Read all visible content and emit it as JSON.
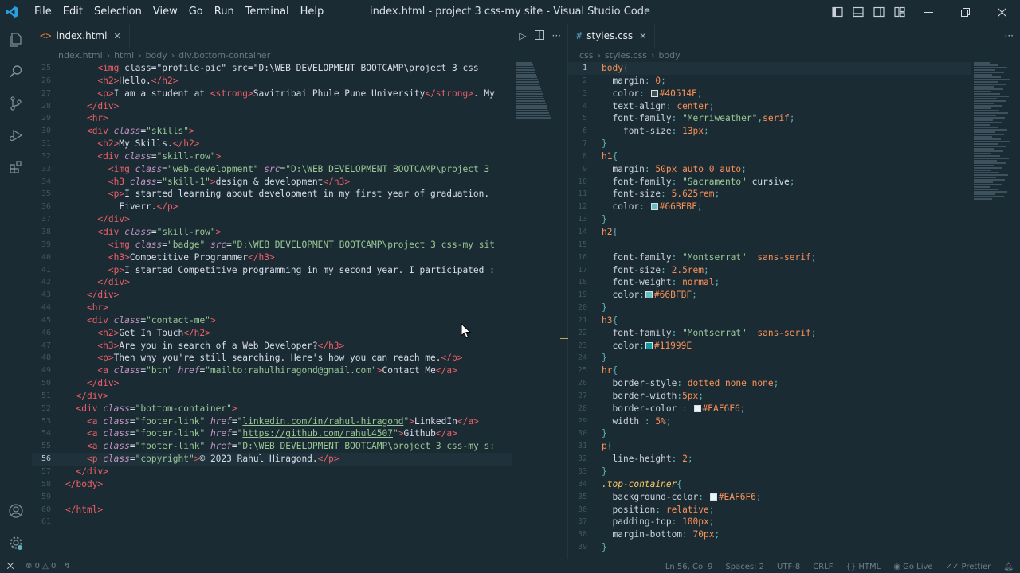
{
  "window": {
    "title": "index.html - project 3 css-my site - Visual Studio Code",
    "menu": [
      "File",
      "Edit",
      "Selection",
      "View",
      "Go",
      "Run",
      "Terminal",
      "Help"
    ]
  },
  "left_editor": {
    "tab": {
      "label": "index.html"
    },
    "breadcrumb": [
      "index.html",
      "html",
      "body",
      "div.bottom-container"
    ],
    "first_line": 25,
    "current_line": 56
  },
  "right_editor": {
    "tab": {
      "label": "styles.css"
    },
    "breadcrumb": [
      "css",
      "styles.css",
      "body"
    ],
    "first_line": 1,
    "current_line": 1
  },
  "html_lines": [
    [
      [
        "pl",
        "      "
      ],
      [
        "tg",
        "<img"
      ],
      [
        "pl",
        " class=\"profile-pic\" src=\"D:\\WEB DEVELOPMENT BOOTCAMP\\project 3 css"
      ]
    ],
    [
      [
        "pl",
        "      "
      ],
      [
        "tg",
        "<h2>"
      ],
      [
        "pl",
        "Hello."
      ],
      [
        "tg",
        "</h2>"
      ]
    ],
    [
      [
        "pl",
        "      "
      ],
      [
        "tg",
        "<p>"
      ],
      [
        "pl",
        "I am a student at "
      ],
      [
        "tg",
        "<strong>"
      ],
      [
        "pl",
        "Savitribai Phule Pune University"
      ],
      [
        "tg",
        "</strong>"
      ],
      [
        "pl",
        ". My"
      ]
    ],
    [
      [
        "pl",
        "    "
      ],
      [
        "tg",
        "</div>"
      ]
    ],
    [
      [
        "pl",
        "    "
      ],
      [
        "tg",
        "<hr>"
      ]
    ],
    [
      [
        "pl",
        "    "
      ],
      [
        "tg",
        "<div"
      ],
      [
        "pl",
        " "
      ],
      [
        "at",
        "class"
      ],
      [
        "pl",
        "="
      ],
      [
        "st",
        "\"skills\""
      ],
      [
        "tg",
        ">"
      ]
    ],
    [
      [
        "pl",
        "      "
      ],
      [
        "tg",
        "<h2>"
      ],
      [
        "pl",
        "My Skills."
      ],
      [
        "tg",
        "</h2>"
      ]
    ],
    [
      [
        "pl",
        "      "
      ],
      [
        "tg",
        "<div"
      ],
      [
        "pl",
        " "
      ],
      [
        "at",
        "class"
      ],
      [
        "pl",
        "="
      ],
      [
        "st",
        "\"skill-row\""
      ],
      [
        "tg",
        ">"
      ]
    ],
    [
      [
        "pl",
        "        "
      ],
      [
        "tg",
        "<img"
      ],
      [
        "pl",
        " "
      ],
      [
        "at",
        "class"
      ],
      [
        "pl",
        "="
      ],
      [
        "st",
        "\"web-development\""
      ],
      [
        "pl",
        " "
      ],
      [
        "at",
        "src"
      ],
      [
        "pl",
        "="
      ],
      [
        "st",
        "\"D:\\WEB DEVELOPMENT BOOTCAMP\\project 3"
      ]
    ],
    [
      [
        "pl",
        "        "
      ],
      [
        "tg",
        "<h3"
      ],
      [
        "pl",
        " "
      ],
      [
        "at",
        "class"
      ],
      [
        "pl",
        "="
      ],
      [
        "st",
        "\"skill-1\""
      ],
      [
        "tg",
        ">"
      ],
      [
        "pl",
        "design & development"
      ],
      [
        "tg",
        "</h3>"
      ]
    ],
    [
      [
        "pl",
        "        "
      ],
      [
        "tg",
        "<p>"
      ],
      [
        "pl",
        "I started learning about development in my first year of graduation."
      ]
    ],
    [
      [
        "pl",
        "          Fiverr."
      ],
      [
        "tg",
        "</p>"
      ]
    ],
    [
      [
        "pl",
        "      "
      ],
      [
        "tg",
        "</div>"
      ]
    ],
    [
      [
        "pl",
        "      "
      ],
      [
        "tg",
        "<div"
      ],
      [
        "pl",
        " "
      ],
      [
        "at",
        "class"
      ],
      [
        "pl",
        "="
      ],
      [
        "st",
        "\"skill-row\""
      ],
      [
        "tg",
        ">"
      ]
    ],
    [
      [
        "pl",
        "        "
      ],
      [
        "tg",
        "<img"
      ],
      [
        "pl",
        " "
      ],
      [
        "at",
        "class"
      ],
      [
        "pl",
        "="
      ],
      [
        "st",
        "\"badge\""
      ],
      [
        "pl",
        " "
      ],
      [
        "at",
        "src"
      ],
      [
        "pl",
        "="
      ],
      [
        "st",
        "\"D:\\WEB DEVELOPMENT BOOTCAMP\\project 3 css-my sit"
      ]
    ],
    [
      [
        "pl",
        "        "
      ],
      [
        "tg",
        "<h3>"
      ],
      [
        "pl",
        "Competitive Programmer"
      ],
      [
        "tg",
        "</h3>"
      ]
    ],
    [
      [
        "pl",
        "        "
      ],
      [
        "tg",
        "<p>"
      ],
      [
        "pl",
        "I started Competitive programming in my second year. I participated :"
      ]
    ],
    [
      [
        "pl",
        "      "
      ],
      [
        "tg",
        "</div>"
      ]
    ],
    [
      [
        "pl",
        "    "
      ],
      [
        "tg",
        "</div>"
      ]
    ],
    [
      [
        "pl",
        "    "
      ],
      [
        "tg",
        "<hr>"
      ]
    ],
    [
      [
        "pl",
        "    "
      ],
      [
        "tg",
        "<div"
      ],
      [
        "pl",
        " "
      ],
      [
        "at",
        "class"
      ],
      [
        "pl",
        "="
      ],
      [
        "st",
        "\"contact-me\""
      ],
      [
        "tg",
        ">"
      ]
    ],
    [
      [
        "pl",
        "      "
      ],
      [
        "tg",
        "<h2>"
      ],
      [
        "pl",
        "Get In Touch"
      ],
      [
        "tg",
        "</h2>"
      ]
    ],
    [
      [
        "pl",
        "      "
      ],
      [
        "tg",
        "<h3>"
      ],
      [
        "pl",
        "Are you in search of a Web Developer?"
      ],
      [
        "tg",
        "</h3>"
      ]
    ],
    [
      [
        "pl",
        "      "
      ],
      [
        "tg",
        "<p>"
      ],
      [
        "pl",
        "Then why you're still searching. Here's how you can reach me."
      ],
      [
        "tg",
        "</p>"
      ]
    ],
    [
      [
        "pl",
        "      "
      ],
      [
        "tg",
        "<a"
      ],
      [
        "pl",
        " "
      ],
      [
        "at",
        "class"
      ],
      [
        "pl",
        "="
      ],
      [
        "st",
        "\"btn\""
      ],
      [
        "pl",
        " "
      ],
      [
        "at",
        "href"
      ],
      [
        "pl",
        "="
      ],
      [
        "st",
        "\"mailto:rahulhiragond@gmail.com\""
      ],
      [
        "tg",
        ">"
      ],
      [
        "pl",
        "Contact Me"
      ],
      [
        "tg",
        "</a>"
      ]
    ],
    [
      [
        "pl",
        "    "
      ],
      [
        "tg",
        "</div>"
      ]
    ],
    [
      [
        "pl",
        "  "
      ],
      [
        "tg",
        "</div>"
      ]
    ],
    [
      [
        "pl",
        "  "
      ],
      [
        "tg",
        "<div"
      ],
      [
        "pl",
        " "
      ],
      [
        "at",
        "class"
      ],
      [
        "pl",
        "="
      ],
      [
        "st",
        "\"bottom-container\""
      ],
      [
        "tg",
        ">"
      ]
    ],
    [
      [
        "pl",
        "    "
      ],
      [
        "tg",
        "<a"
      ],
      [
        "pl",
        " "
      ],
      [
        "at",
        "class"
      ],
      [
        "pl",
        "="
      ],
      [
        "st",
        "\"footer-link\""
      ],
      [
        "pl",
        " "
      ],
      [
        "at",
        "href"
      ],
      [
        "pl",
        "="
      ],
      [
        "st",
        "\""
      ],
      [
        "lk",
        "linkedin.com/in/rahul-hiragond"
      ],
      [
        "st",
        "\""
      ],
      [
        "tg",
        ">"
      ],
      [
        "pl",
        "LinkedIn"
      ],
      [
        "tg",
        "</a>"
      ]
    ],
    [
      [
        "pl",
        "    "
      ],
      [
        "tg",
        "<a"
      ],
      [
        "pl",
        " "
      ],
      [
        "at",
        "class"
      ],
      [
        "pl",
        "="
      ],
      [
        "st",
        "\"footer-link\""
      ],
      [
        "pl",
        " "
      ],
      [
        "at",
        "href"
      ],
      [
        "pl",
        "="
      ],
      [
        "st",
        "\""
      ],
      [
        "lk",
        "https://github.com/rahul4507"
      ],
      [
        "st",
        "\""
      ],
      [
        "tg",
        ">"
      ],
      [
        "pl",
        "Github"
      ],
      [
        "tg",
        "</a>"
      ]
    ],
    [
      [
        "pl",
        "    "
      ],
      [
        "tg",
        "<a"
      ],
      [
        "pl",
        " "
      ],
      [
        "at",
        "class"
      ],
      [
        "pl",
        "="
      ],
      [
        "st",
        "\"footer-link\""
      ],
      [
        "pl",
        " "
      ],
      [
        "at",
        "href"
      ],
      [
        "pl",
        "="
      ],
      [
        "st",
        "\"D:\\WEB DEVELOPMENT BOOTCAMP\\project 3 css-my s:"
      ]
    ],
    [
      [
        "pl",
        "    "
      ],
      [
        "tg",
        "<p"
      ],
      [
        "pl",
        " "
      ],
      [
        "at",
        "class"
      ],
      [
        "pl",
        "="
      ],
      [
        "st",
        "\"copyright\""
      ],
      [
        "tg",
        ">"
      ],
      [
        "pl",
        "© 2023 Rahul Hiragond."
      ],
      [
        "tg",
        "</p>"
      ]
    ],
    [
      [
        "pl",
        "  "
      ],
      [
        "tg",
        "</div>"
      ]
    ],
    [
      [
        "tg",
        "</body>"
      ]
    ],
    [
      [
        "pl",
        ""
      ]
    ],
    [
      [
        "tg",
        "</html>"
      ]
    ],
    [
      [
        "pl",
        ""
      ]
    ]
  ],
  "css_lines": [
    [
      [
        "sel",
        "body"
      ],
      [
        "pn",
        "{"
      ]
    ],
    [
      [
        "pl",
        "  "
      ],
      [
        "pr",
        "margin"
      ],
      [
        "pn",
        ": "
      ],
      [
        "nm",
        "0"
      ],
      [
        "pn",
        ";"
      ]
    ],
    [
      [
        "pl",
        "  "
      ],
      [
        "pr",
        "color"
      ],
      [
        "pn",
        ": "
      ],
      [
        "sw",
        "#40514E"
      ],
      [
        "vl",
        "#40514E"
      ],
      [
        "pn",
        ";"
      ]
    ],
    [
      [
        "pl",
        "  "
      ],
      [
        "pr",
        "text-align"
      ],
      [
        "pn",
        ": "
      ],
      [
        "vl",
        "center"
      ],
      [
        "pn",
        ";"
      ]
    ],
    [
      [
        "pl",
        "  "
      ],
      [
        "pr",
        "font-family"
      ],
      [
        "pn",
        ": "
      ],
      [
        "st",
        "\"Merriweather\""
      ],
      [
        "pn",
        ","
      ],
      [
        "vl",
        "serif"
      ],
      [
        "pn",
        ";"
      ]
    ],
    [
      [
        "pl",
        "    "
      ],
      [
        "pr",
        "font-size"
      ],
      [
        "pn",
        ": "
      ],
      [
        "nm",
        "13px"
      ],
      [
        "pn",
        ";"
      ]
    ],
    [
      [
        "pn",
        "}"
      ]
    ],
    [
      [
        "sel",
        "h1"
      ],
      [
        "pn",
        "{"
      ]
    ],
    [
      [
        "pl",
        "  "
      ],
      [
        "pr",
        "margin"
      ],
      [
        "pn",
        ": "
      ],
      [
        "nm",
        "50px auto 0 auto"
      ],
      [
        "pn",
        ";"
      ]
    ],
    [
      [
        "pl",
        "  "
      ],
      [
        "pr",
        "font-family"
      ],
      [
        "pn",
        ": "
      ],
      [
        "st",
        "\"Sacramento\""
      ],
      [
        "pl",
        " cursive"
      ],
      [
        "pn",
        ";"
      ]
    ],
    [
      [
        "pl",
        "  "
      ],
      [
        "pr",
        "font-size"
      ],
      [
        "pn",
        ": "
      ],
      [
        "nm",
        "5.625rem"
      ],
      [
        "pn",
        ";"
      ]
    ],
    [
      [
        "pl",
        "  "
      ],
      [
        "pr",
        "color"
      ],
      [
        "pn",
        ": "
      ],
      [
        "sw",
        "#66BFBF"
      ],
      [
        "vl",
        "#66BFBF"
      ],
      [
        "pn",
        ";"
      ]
    ],
    [
      [
        "pn",
        "}"
      ]
    ],
    [
      [
        "sel",
        "h2"
      ],
      [
        "pn",
        "{"
      ]
    ],
    [
      [
        "pl",
        ""
      ]
    ],
    [
      [
        "pl",
        "  "
      ],
      [
        "pr",
        "font-family"
      ],
      [
        "pn",
        ": "
      ],
      [
        "st",
        "\"Montserrat\""
      ],
      [
        "pl",
        "  "
      ],
      [
        "vl",
        "sans-serif"
      ],
      [
        "pn",
        ";"
      ]
    ],
    [
      [
        "pl",
        "  "
      ],
      [
        "pr",
        "font-size"
      ],
      [
        "pn",
        ": "
      ],
      [
        "nm",
        "2.5rem"
      ],
      [
        "pn",
        ";"
      ]
    ],
    [
      [
        "pl",
        "  "
      ],
      [
        "pr",
        "font-weight"
      ],
      [
        "pn",
        ": "
      ],
      [
        "vl",
        "normal"
      ],
      [
        "pn",
        ";"
      ]
    ],
    [
      [
        "pl",
        "  "
      ],
      [
        "pr",
        "color"
      ],
      [
        "pn",
        ":"
      ],
      [
        "sw",
        "#66BFBF"
      ],
      [
        "vl",
        "#66BFBF"
      ],
      [
        "pn",
        ";"
      ]
    ],
    [
      [
        "pn",
        "}"
      ]
    ],
    [
      [
        "sel",
        "h3"
      ],
      [
        "pn",
        "{"
      ]
    ],
    [
      [
        "pl",
        "  "
      ],
      [
        "pr",
        "font-family"
      ],
      [
        "pn",
        ": "
      ],
      [
        "st",
        "\"Montserrat\""
      ],
      [
        "pl",
        "  "
      ],
      [
        "vl",
        "sans-serif"
      ],
      [
        "pn",
        ";"
      ]
    ],
    [
      [
        "pl",
        "  "
      ],
      [
        "pr",
        "color"
      ],
      [
        "pn",
        ":"
      ],
      [
        "sw",
        "#11999E"
      ],
      [
        "vl",
        "#11999E"
      ]
    ],
    [
      [
        "pn",
        "}"
      ]
    ],
    [
      [
        "sel",
        "hr"
      ],
      [
        "pn",
        "{"
      ]
    ],
    [
      [
        "pl",
        "  "
      ],
      [
        "pr",
        "border-style"
      ],
      [
        "pn",
        ": "
      ],
      [
        "vl",
        "dotted none none"
      ],
      [
        "pn",
        ";"
      ]
    ],
    [
      [
        "pl",
        "  "
      ],
      [
        "pr",
        "border-width"
      ],
      [
        "pn",
        ":"
      ],
      [
        "nm",
        "5px"
      ],
      [
        "pn",
        ";"
      ]
    ],
    [
      [
        "pl",
        "  "
      ],
      [
        "pr",
        "border-color"
      ],
      [
        "pn",
        " : "
      ],
      [
        "sw",
        "#EAF6F6"
      ],
      [
        "vl",
        "#EAF6F6"
      ],
      [
        "pn",
        ";"
      ]
    ],
    [
      [
        "pl",
        "  "
      ],
      [
        "pr",
        "width"
      ],
      [
        "pn",
        " : "
      ],
      [
        "nm",
        "5%"
      ],
      [
        "pn",
        ";"
      ]
    ],
    [
      [
        "pn",
        "}"
      ]
    ],
    [
      [
        "sel",
        "p"
      ],
      [
        "pn",
        "{"
      ]
    ],
    [
      [
        "pl",
        "  "
      ],
      [
        "pr",
        "line-height"
      ],
      [
        "pn",
        ": "
      ],
      [
        "nm",
        "2"
      ],
      [
        "pn",
        ";"
      ]
    ],
    [
      [
        "pn",
        "}"
      ]
    ],
    [
      [
        "cls",
        ".top-container"
      ],
      [
        "pn",
        "{"
      ]
    ],
    [
      [
        "pl",
        "  "
      ],
      [
        "pr",
        "background-color"
      ],
      [
        "pn",
        ": "
      ],
      [
        "sw",
        "#EAF6F6"
      ],
      [
        "vl",
        "#EAF6F6"
      ],
      [
        "pn",
        ";"
      ]
    ],
    [
      [
        "pl",
        "  "
      ],
      [
        "pr",
        "position"
      ],
      [
        "pn",
        ": "
      ],
      [
        "vl",
        "relative"
      ],
      [
        "pn",
        ";"
      ]
    ],
    [
      [
        "pl",
        "  "
      ],
      [
        "pr",
        "padding-top"
      ],
      [
        "pn",
        ": "
      ],
      [
        "nm",
        "100px"
      ],
      [
        "pn",
        ";"
      ]
    ],
    [
      [
        "pl",
        "  "
      ],
      [
        "pr",
        "margin-bottom"
      ],
      [
        "pn",
        ": "
      ],
      [
        "nm",
        "70px"
      ],
      [
        "pn",
        ";"
      ]
    ],
    [
      [
        "pn",
        "}"
      ]
    ]
  ],
  "status": {
    "errors": "0",
    "warnings": "0",
    "position": "Ln 56, Col 9",
    "spaces": "Spaces: 2",
    "encoding": "UTF-8",
    "eol": "CRLF",
    "language": "HTML",
    "golive": "Go Live",
    "prettier": "Prettier"
  },
  "colors": {
    "background": "#1b2b34",
    "tag": "#ec5f67",
    "attribute": "#c594c5",
    "string": "#99c794",
    "number": "#f99157",
    "class_selector": "#fac863"
  },
  "icons": {
    "activity": [
      "explorer-icon",
      "search-icon",
      "source-control-icon",
      "run-debug-icon",
      "extensions-icon",
      "account-icon",
      "settings-gear-icon"
    ]
  }
}
